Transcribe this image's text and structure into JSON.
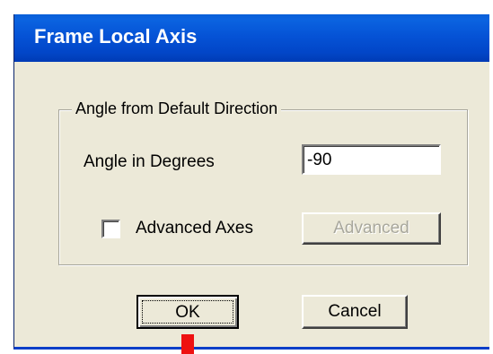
{
  "window": {
    "title": "Frame Local Axis"
  },
  "group": {
    "legend": "Angle from Default Direction",
    "angle_label": "Angle in Degrees",
    "angle_value": "-90",
    "advanced_axes_label": "Advanced Axes",
    "advanced_axes_checked": false,
    "advanced_button": "Advanced"
  },
  "buttons": {
    "ok": "OK",
    "cancel": "Cancel"
  },
  "colors": {
    "titlebar": "#0553d6",
    "dialog_bg": "#ece9d8",
    "marker": "#ee1111"
  }
}
